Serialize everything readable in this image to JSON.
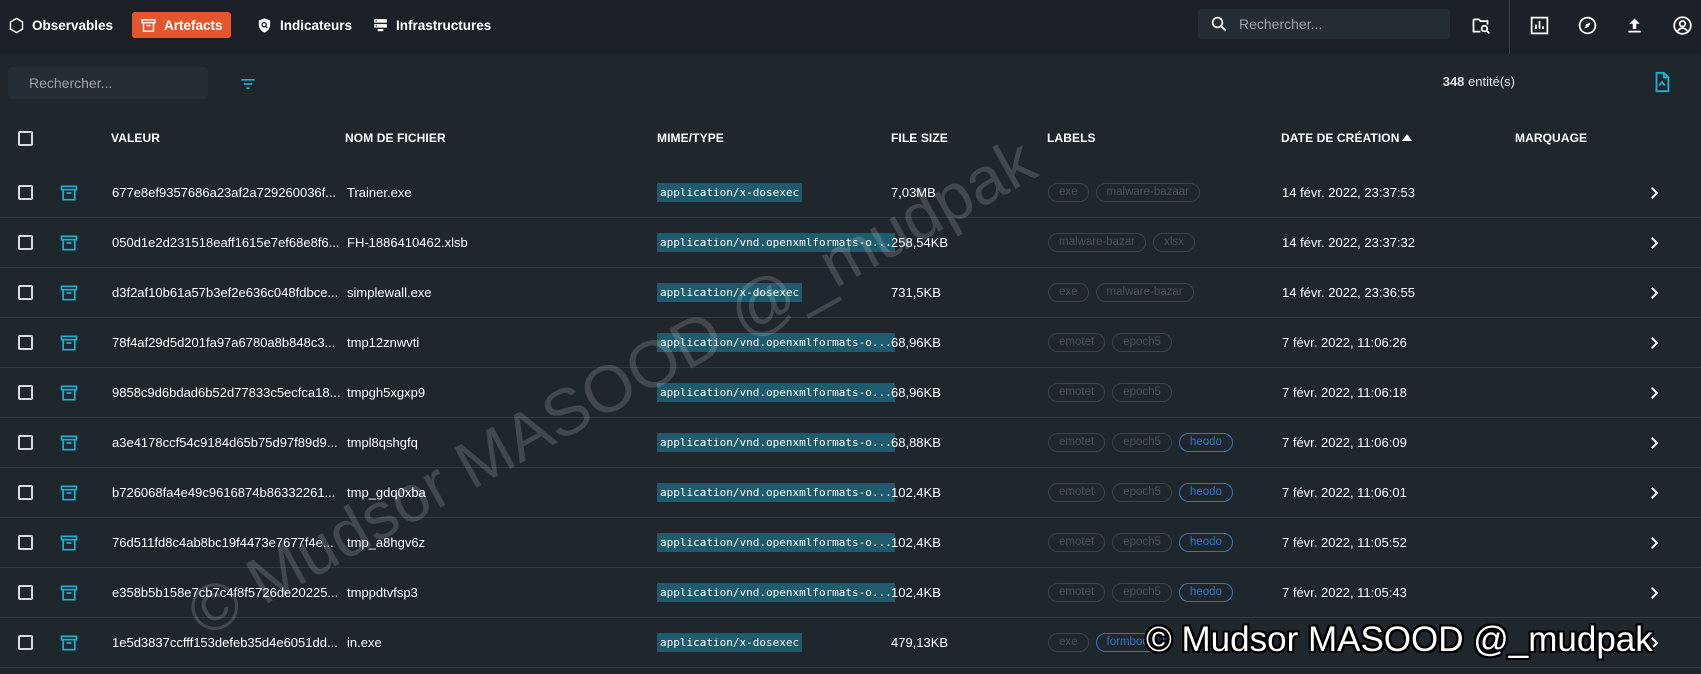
{
  "nav": {
    "items": [
      {
        "label": "Observables",
        "icon": "hexagon-icon",
        "active": false
      },
      {
        "label": "Artefacts",
        "icon": "archive-icon",
        "active": true
      },
      {
        "label": "Indicateurs",
        "icon": "shield-search-icon",
        "active": false
      },
      {
        "label": "Infrastructures",
        "icon": "server-icon",
        "active": false
      }
    ],
    "accent_color": "#e4572e"
  },
  "top_search": {
    "placeholder": "Rechercher..."
  },
  "list_search": {
    "placeholder": "Rechercher..."
  },
  "entity_count": {
    "number": "348",
    "suffix": " entité(s)"
  },
  "table": {
    "columns": [
      "Valeur",
      "Nom de fichier",
      "Mime/Type",
      "File size",
      "Labels",
      "Date de création",
      "Marquage"
    ],
    "sort_column": "Date de création",
    "rows": [
      {
        "value": "677e8ef9357686a23af2a729260036f...",
        "file": "Trainer.exe",
        "mime": "application/x-dosexec",
        "size": "7,03MB",
        "labels": [
          "exe",
          "malware-bazaar"
        ],
        "date": "14 févr. 2022, 23:37:53"
      },
      {
        "value": "050d1e2d231518eaff1615e7ef68e8f6...",
        "file": "FH-1886410462.xlsb",
        "mime": "application/vnd.openxmlformats-o...",
        "size": "258,54KB",
        "labels": [
          "malware-bazar",
          "xlsx"
        ],
        "date": "14 févr. 2022, 23:37:32"
      },
      {
        "value": "d3f2af10b61a57b3ef2e636c048fdbce...",
        "file": "simplewall.exe",
        "mime": "application/x-dosexec",
        "size": "731,5KB",
        "labels": [
          "exe",
          "malware-bazar"
        ],
        "date": "14 févr. 2022, 23:36:55"
      },
      {
        "value": "78f4af29d5d201fa97a6780a8b848c3...",
        "file": "tmp12znwvti",
        "mime": "application/vnd.openxmlformats-o...",
        "size": "68,96KB",
        "labels": [
          "emotet",
          "epoch5"
        ],
        "date": "7 févr. 2022, 11:06:26"
      },
      {
        "value": "9858c9d6bdad6b52d77833c5ecfca18...",
        "file": "tmpgh5xgxp9",
        "mime": "application/vnd.openxmlformats-o...",
        "size": "68,96KB",
        "labels": [
          "emotet",
          "epoch5"
        ],
        "date": "7 févr. 2022, 11:06:18"
      },
      {
        "value": "a3e4178ccf54c9184d65b75d97f89d9...",
        "file": "tmpl8qshgfq",
        "mime": "application/vnd.openxmlformats-o...",
        "size": "68,88KB",
        "labels": [
          "emotet",
          "epoch5",
          "heodo"
        ],
        "date": "7 févr. 2022, 11:06:09"
      },
      {
        "value": "b726068fa4e49c9616874b86332261...",
        "file": "tmp_gdq0xba",
        "mime": "application/vnd.openxmlformats-o...",
        "size": "102,4KB",
        "labels": [
          "emotet",
          "epoch5",
          "heodo"
        ],
        "date": "7 févr. 2022, 11:06:01"
      },
      {
        "value": "76d511fd8c4ab8bc19f4473e7677f4e...",
        "file": "tmp_a8hgv6z",
        "mime": "application/vnd.openxmlformats-o...",
        "size": "102,4KB",
        "labels": [
          "emotet",
          "epoch5",
          "heodo"
        ],
        "date": "7 févr. 2022, 11:05:52"
      },
      {
        "value": "e358b5b158e7cb7c4f8f5726de20225...",
        "file": "tmppdtvfsp3",
        "mime": "application/vnd.openxmlformats-o...",
        "size": "102,4KB",
        "labels": [
          "emotet",
          "epoch5",
          "heodo"
        ],
        "date": "7 févr. 2022, 11:05:43"
      },
      {
        "value": "1e5d3837ccfff153defeb35d4e6051dd...",
        "file": "in.exe",
        "mime": "application/x-dosexec",
        "size": "479,13KB",
        "labels": [
          "exe",
          "formbook"
        ],
        "date": ""
      }
    ]
  },
  "watermark": {
    "text": "© Mudsor MASOOD @_mudpak"
  }
}
